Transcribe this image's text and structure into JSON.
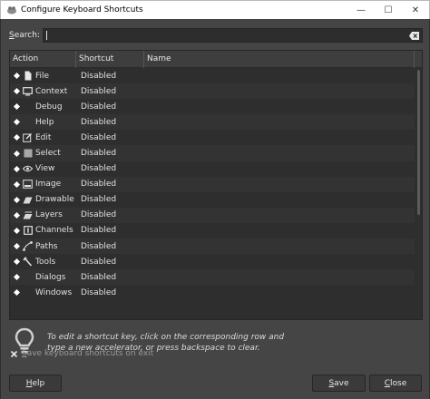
{
  "window": {
    "title": "Configure Keyboard Shortcuts",
    "minimize": "—",
    "maximize": "☐",
    "close": "✕"
  },
  "search": {
    "label_underlined": "S",
    "label_rest": "earch:",
    "value": "",
    "placeholder": ""
  },
  "columns": {
    "action": "Action",
    "shortcut": "Shortcut",
    "name": "Name"
  },
  "rows": [
    {
      "label": "File",
      "shortcut": "Disabled",
      "icon": "file-icon"
    },
    {
      "label": "Context",
      "shortcut": "Disabled",
      "icon": "context-icon"
    },
    {
      "label": "Debug",
      "shortcut": "Disabled",
      "icon": "none"
    },
    {
      "label": "Help",
      "shortcut": "Disabled",
      "icon": "none"
    },
    {
      "label": "Edit",
      "shortcut": "Disabled",
      "icon": "edit-icon"
    },
    {
      "label": "Select",
      "shortcut": "Disabled",
      "icon": "select-icon"
    },
    {
      "label": "View",
      "shortcut": "Disabled",
      "icon": "view-icon"
    },
    {
      "label": "Image",
      "shortcut": "Disabled",
      "icon": "image-icon"
    },
    {
      "label": "Drawable",
      "shortcut": "Disabled",
      "icon": "drawable-icon"
    },
    {
      "label": "Layers",
      "shortcut": "Disabled",
      "icon": "layers-icon"
    },
    {
      "label": "Channels",
      "shortcut": "Disabled",
      "icon": "channels-icon"
    },
    {
      "label": "Paths",
      "shortcut": "Disabled",
      "icon": "paths-icon"
    },
    {
      "label": "Tools",
      "shortcut": "Disabled",
      "icon": "tools-icon"
    },
    {
      "label": "Dialogs",
      "shortcut": "Disabled",
      "icon": "none"
    },
    {
      "label": "Windows",
      "shortcut": "Disabled",
      "icon": "none"
    }
  ],
  "hint": {
    "line1": "To edit a shortcut key, click on the corresponding row and",
    "line2": "type a new accelerator, or press backspace to clear."
  },
  "save_on_exit": {
    "label_underlined": "S",
    "label_rest": "ave keyboard shortcuts on exit",
    "checked": true
  },
  "buttons": {
    "help_u": "H",
    "help_rest": "elp",
    "save_u": "S",
    "save_rest": "ave",
    "close_u": "C",
    "close_rest": "lose"
  },
  "colors": {
    "background": "#454545",
    "tree_background": "#2e2e2e",
    "text": "#e0e0e0"
  }
}
